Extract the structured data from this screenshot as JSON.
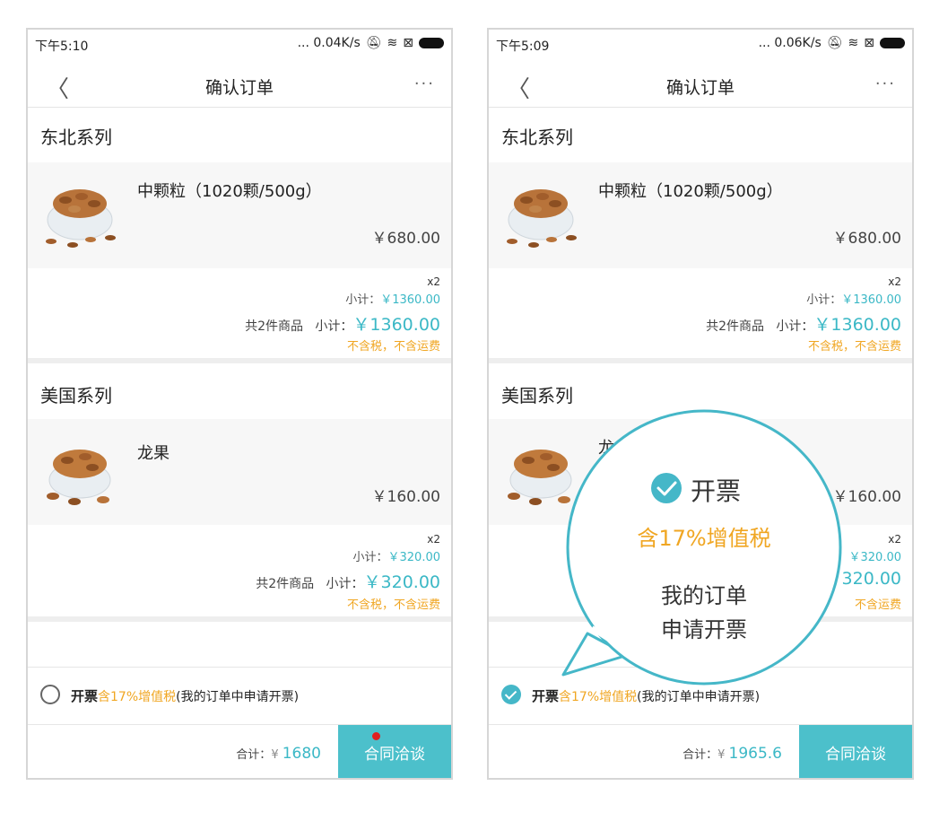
{
  "icons": {
    "signal": "signal-dots-icon",
    "mute": "bell-off-icon",
    "wifi": "wifi-icon",
    "sim": "sim-icon",
    "battery": "battery-icon",
    "back": "chevron-left-icon",
    "more": "more-horizontal-icon",
    "check": "check-circle-icon"
  },
  "colors": {
    "accent": "#4cc0cb",
    "price_blue": "#3bb8c6",
    "orange": "#f0a622"
  },
  "left": {
    "status": {
      "time": "下午5:10",
      "speed": "... 0.04K/s"
    },
    "nav": {
      "back": "〈",
      "title": "确认订单",
      "more": "···"
    },
    "groups": [
      {
        "title": "东北系列",
        "product": "中颗粒（1020颗/500g）",
        "price": "￥680.00",
        "qty": "x2",
        "subtotal_label": "小计：",
        "subtotal": "￥1360.00",
        "count": "共2件商品",
        "sum_label": "小计：",
        "sum": "￥1360.00",
        "tax": "不含税，不含运费"
      },
      {
        "title": "美国系列",
        "product": "龙果",
        "price": "￥160.00",
        "qty": "x2",
        "subtotal_label": "小计：",
        "subtotal": "￥320.00",
        "count": "共2件商品",
        "sum_label": "小计：",
        "sum": "￥320.00",
        "tax": "不含税，不含运费"
      }
    ],
    "invoice": {
      "label": "开票",
      "tax": "含17%增值税",
      "note": "(我的订单中申请开票)",
      "checked": false
    },
    "footer": {
      "total_label": "合计：",
      "currency": "¥",
      "total": "1680",
      "button": "合同洽谈"
    }
  },
  "right": {
    "status": {
      "time": "下午5:09",
      "speed": "... 0.06K/s"
    },
    "nav": {
      "back": "〈",
      "title": "确认订单",
      "more": "···"
    },
    "groups": [
      {
        "title": "东北系列",
        "product": "中颗粒（1020颗/500g）",
        "price": "￥680.00",
        "qty": "x2",
        "subtotal_label": "小计：",
        "subtotal": "￥1360.00",
        "count": "共2件商品",
        "sum_label": "小计：",
        "sum": "￥1360.00",
        "tax": "不含税，不含运费"
      },
      {
        "title": "美国系列",
        "product": "龙",
        "price": "￥160.00",
        "qty": "x2",
        "subtotal": "￥320.00",
        "sum": "320.00",
        "tax": "不含运费"
      }
    ],
    "invoice": {
      "label": "开票",
      "tax": "含17%增值税",
      "note": "(我的订单中申请开票)",
      "checked": true
    },
    "footer": {
      "total_label": "合计：",
      "currency": "¥",
      "total": "1965.6",
      "button": "合同洽谈"
    }
  },
  "callout": {
    "line1": "开票",
    "line2": "含17%增值税",
    "line3": "我的订单",
    "line4": "申请开票"
  }
}
